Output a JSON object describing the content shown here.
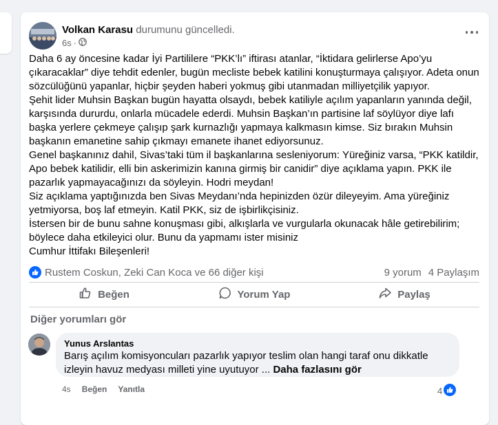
{
  "post": {
    "author": "Volkan Karasu",
    "action": "durumunu güncelledi.",
    "time": "6s",
    "paragraphs": [
      "Daha 6 ay öncesine kadar İyi Partililere “PKK’lı” iftirası atanlar, “İktidara gelirlerse Apo’yu çıkaracaklar” diye tehdit edenler, bugün mecliste bebek katilini konuşturmaya çalışıyor. Adeta onun sözcülüğünü yapanlar, hiçbir şeyden haberi yokmuş gibi utanmadan milliyetçilik yapıyor.",
      "Şehit lider Muhsin Başkan bugün hayatta olsaydı, bebek katiliyle açılım yapanların yanında değil, karşısında dururdu, onlarla mücadele ederdi. Muhsin Başkan’ın partisine laf söylüyor diye lafı başka yerlere çekmeye çalışıp şark kurnazlığı yapmaya kalkmasın kimse. Siz bırakın Muhsin başkanın emanetine sahip çıkmayı emanete ihanet ediyorsunuz.",
      "Genel başkanınız dahil, Sivas’taki tüm il başkanlarına sesleniyorum: Yüreğiniz varsa, “PKK katildir, Apo bebek katilidir, elli bin askerimizin kanına girmiş bir canidir” diye açıklama yapın. PKK ile pazarlık yapmayacağınızı da söyleyin. Hodri meydan!",
      "Siz açıklama yaptığınızda ben Sivas Meydanı’nda hepinizden özür dileyeyim. Ama yüreğiniz yetmiyorsa, boş laf etmeyin. Katil PKK, siz de işbirlikçisiniz.",
      "İstersen bir de bunu sahne konuşması gibi, alkışlarla ve vurgularla okunacak hâle getirebilirim; böylece daha etkileyici olur. Bunu da yapmamı ister misiniz",
      "Cumhur İttifakı Bileşenleri!"
    ],
    "reactions_text": "Rustem Coskun, Zeki Can Koca ve 66 diğer kişi",
    "comments_count": "9 yorum",
    "shares_count": "4 Paylaşım"
  },
  "actions": {
    "like": "Beğen",
    "comment": "Yorum Yap",
    "share": "Paylaş"
  },
  "comments_section": {
    "view_more": "Diğer yorumları gör",
    "comment": {
      "author": "Yunus Arslantas",
      "text": "Barış açılım komisyoncuları pazarlık yapıyor teslim olan hangi taraf onu dikkatle izleyin havuz medyası milleti yine uyutuyor ...",
      "see_more": "Daha fazlasını gör",
      "time": "4s",
      "like": "Beğen",
      "reply": "Yanıtla",
      "reaction_count": "4"
    }
  },
  "colors": {
    "accent": "#0866ff",
    "secondary_text": "#65676b",
    "background": "#f0f2f5"
  },
  "icons": [
    "globe-icon",
    "more-icon",
    "like-icon",
    "comment-icon",
    "share-icon"
  ]
}
